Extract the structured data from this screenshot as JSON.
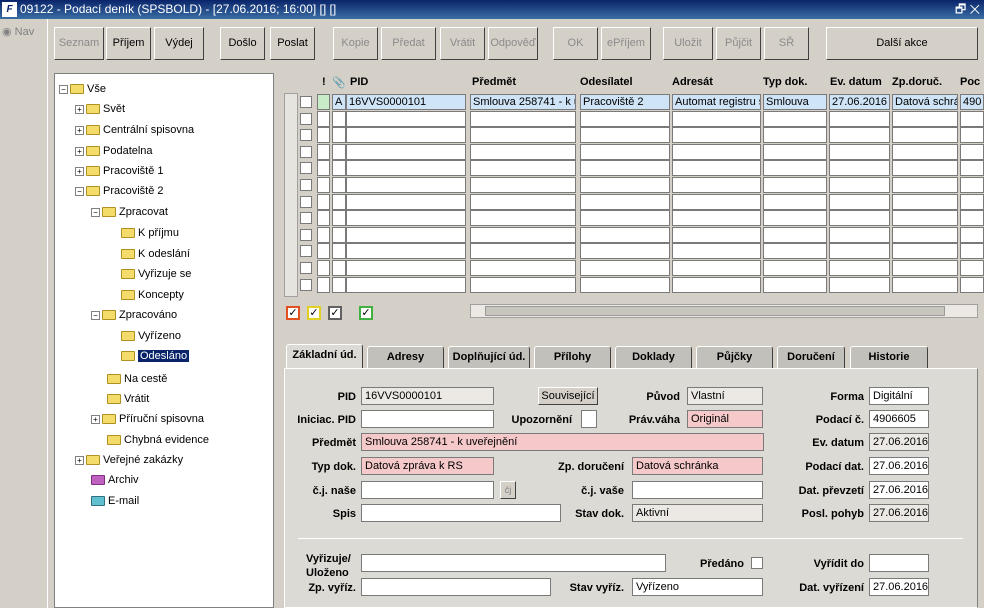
{
  "window": {
    "title": "09122 - Podací deník (SPSBOLD) - [27.06.2016; 16:00] [] []",
    "controls": "🗗 ✕"
  },
  "nav": {
    "label": "Nav"
  },
  "toolbar": {
    "seznam": "Seznam",
    "prijem": "Příjem",
    "vydej": "Výdej",
    "doslo": "Došlo",
    "poslat": "Poslat",
    "kopie": "Kopie",
    "predat": "Předat",
    "vratit": "Vrátit",
    "odpoved": "Odpověď",
    "ok": "OK",
    "eprijem": "ePříjem",
    "ulozit": "Uložit",
    "pujcit": "Půjčit",
    "sr": "SŘ",
    "dalsi": "Další akce"
  },
  "tree": {
    "root": "Vše",
    "svet": "Svět",
    "centralni": "Centrální spisovna",
    "podatelna": "Podatelna",
    "prac1": "Pracoviště 1",
    "prac2": "Pracoviště 2",
    "zpracovat": "Zpracovat",
    "kprijmu": "K příjmu",
    "kodeslani": "K odeslání",
    "vyrizuje": "Vyřizuje se",
    "koncepty": "Koncepty",
    "zpracovano": "Zpracováno",
    "vyrizeno": "Vyřízeno",
    "odeslano": "Odesláno",
    "nacestе": "Na cestě",
    "vratit": "Vrátit",
    "prirucni": "Příruční spisovna",
    "chybna": "Chybná evidence",
    "verejne": "Veřejné zakázky",
    "archiv": "Archiv",
    "email": "E-mail"
  },
  "grid": {
    "headers": {
      "excl": "!",
      "attach": "📎",
      "pid": "PID",
      "predmet": "Předmět",
      "odesilatel": "Odesílatel",
      "adresat": "Adresát",
      "typ": "Typ dok.",
      "evdatum": "Ev. datum",
      "zpdoruc": "Zp.doruč.",
      "pod": "Poc"
    },
    "row1": {
      "flag": "A",
      "pid": "16VVS0000101",
      "predmet": "Smlouva 258741 - k uv",
      "odesilatel": "Pracoviště 2",
      "adresat": "Automat registru s",
      "typ": "Smlouva",
      "evdatum": "27.06.2016",
      "zpdoruc": "Datová schrá",
      "pod": "490"
    }
  },
  "tabs": {
    "zakladni": "Základní úd.",
    "adresy": "Adresy",
    "doplnujici": "Doplňující úd.",
    "prilohy": "Přílohy",
    "doklady": "Doklady",
    "pujcky": "Půjčky",
    "doruceni": "Doručení",
    "historie": "Historie"
  },
  "form": {
    "pid_label": "PID",
    "pid": "16VVS0000101",
    "souvisejici": "Související",
    "puvod_label": "Původ",
    "puvod": "Vlastní",
    "forma_label": "Forma",
    "forma": "Digitální",
    "iniciac_label": "Iniciac. PID",
    "iniciac": "",
    "upozorneni_label": "Upozornění",
    "pravvaha_label": "Práv.váha",
    "pravvaha": "Originál",
    "podacic_label": "Podací č.",
    "podacic": "4906605",
    "predmet_label": "Předmět",
    "predmet": "Smlouva 258741 - k uveřejnění",
    "evdatum_label": "Ev. datum",
    "evdatum": "27.06.2016",
    "typdok_label": "Typ dok.",
    "typdok": "Datová zpráva k RS",
    "zpdoruceni_label": "Zp. doručení",
    "zpdoruceni": "Datová schránka",
    "podacidat_label": "Podací dat.",
    "podacidat": "27.06.2016",
    "cjnase_label": "č.j. naše",
    "cjnase": "",
    "cj_btn": "čj",
    "cjvase_label": "č.j. vaše",
    "cjvase": "",
    "datprevzeti_label": "Dat. převzetí",
    "datprevzeti": "27.06.2016",
    "spis_label": "Spis",
    "spis": "",
    "stavdok_label": "Stav dok.",
    "stavdok": "Aktivní",
    "poslpohyb_label": "Posl. pohyb",
    "poslpohyb": "27.06.2016",
    "vyrizuje_label": "Vyřizuje/",
    "ulozeno_label": "Uloženo",
    "vyrizuje": "",
    "predano_label": "Předáno",
    "vyriditdo_label": "Vyřídit do",
    "vyriditdo": "",
    "zpvyriz_label": "Zp. vyříz.",
    "zpvyriz": "",
    "stavvyriz_label": "Stav vyříz.",
    "stavvyriz": "Vyřízeno",
    "datvyrizeni_label": "Dat. vyřízení",
    "datvyrizeni": "27.06.2016"
  }
}
